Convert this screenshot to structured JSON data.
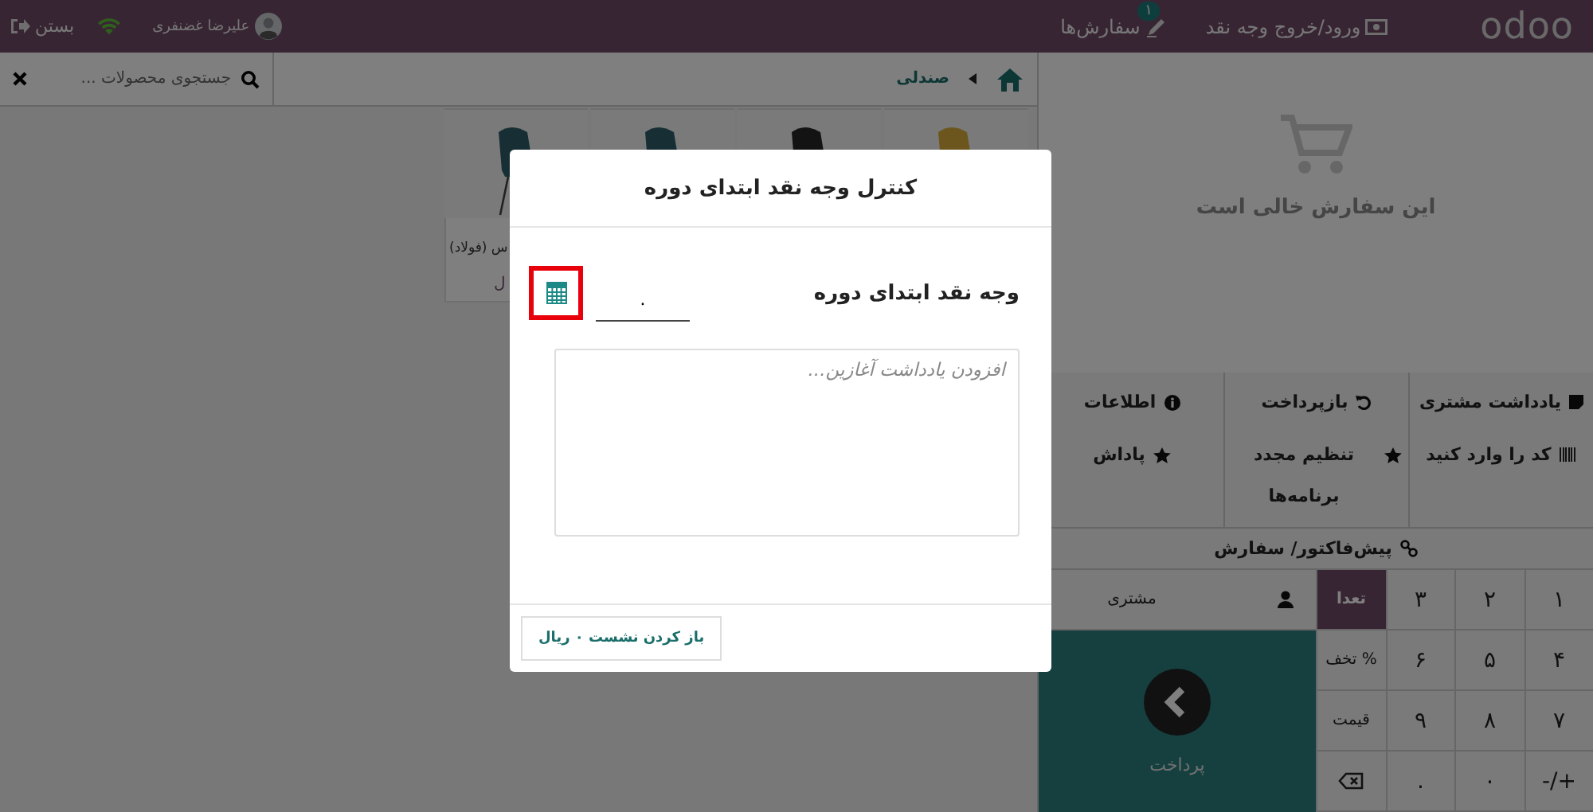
{
  "header": {
    "logo": "odoo",
    "cash_in_out": "ورود/خروج وجه نقد",
    "orders": {
      "label": "سفارش‌ها",
      "badge": "۱"
    },
    "user": "علیرضا غضنفری",
    "close": "بستن"
  },
  "search": {
    "placeholder": "جستجوی محصولات ..."
  },
  "breadcrumb": [
    {
      "label": "صندلی"
    }
  ],
  "products": [
    {
      "kind": "picture"
    },
    {
      "kind": "picture"
    },
    {
      "kind": "picture"
    },
    {
      "kind": "picture",
      "name": "س (فولاد)",
      "price": "ل"
    }
  ],
  "order": {
    "empty_text": "این سفارش خالی است"
  },
  "controls": [
    {
      "kind": "note",
      "label": "یادداشت مشتری"
    },
    {
      "kind": "refund",
      "label": "بازپرداخت"
    },
    {
      "kind": "info",
      "label": "اطلاعات"
    },
    {
      "kind": "barcode",
      "label": "کد را وارد کنید"
    },
    {
      "kind": "reset",
      "label": "تنظیم مجدد برنامه‌ها"
    },
    {
      "kind": "reward",
      "label": "پاداش"
    }
  ],
  "quotation": "پیش‌فاکتور/ سفارش",
  "customer": "مشتری",
  "payment": "پرداخت",
  "numpad": [
    {
      "kind": "key",
      "label": "۱",
      "selected": false
    },
    {
      "kind": "key",
      "label": "۲",
      "selected": false
    },
    {
      "kind": "key",
      "label": "۳",
      "selected": false
    },
    {
      "kind": "key",
      "label": "تعدا",
      "selected": true
    },
    {
      "kind": "key",
      "label": "۴",
      "selected": false
    },
    {
      "kind": "key",
      "label": "۵",
      "selected": false
    },
    {
      "kind": "key",
      "label": "۶",
      "selected": false
    },
    {
      "kind": "key",
      "label": "% تخف",
      "selected": false
    },
    {
      "kind": "key",
      "label": "۷",
      "selected": false
    },
    {
      "kind": "key",
      "label": "۸",
      "selected": false
    },
    {
      "kind": "key",
      "label": "۹",
      "selected": false
    },
    {
      "kind": "key",
      "label": "قیمت",
      "selected": false
    },
    {
      "kind": "key",
      "label": "+/-",
      "selected": false
    },
    {
      "kind": "key",
      "label": "۰",
      "selected": false
    },
    {
      "kind": "key",
      "label": ".",
      "selected": false
    },
    {
      "kind": "backspace",
      "selected": false
    }
  ],
  "modal": {
    "title": "کنترل وجه نقد ابتدای دوره",
    "label": "وجه نقد ابتدای دوره",
    "value": "۰",
    "note_placeholder": "افزودن یادداشت آغازین...",
    "button": "باز کردن نشست ۰ ریال",
    "calculator_highlighted": true
  }
}
